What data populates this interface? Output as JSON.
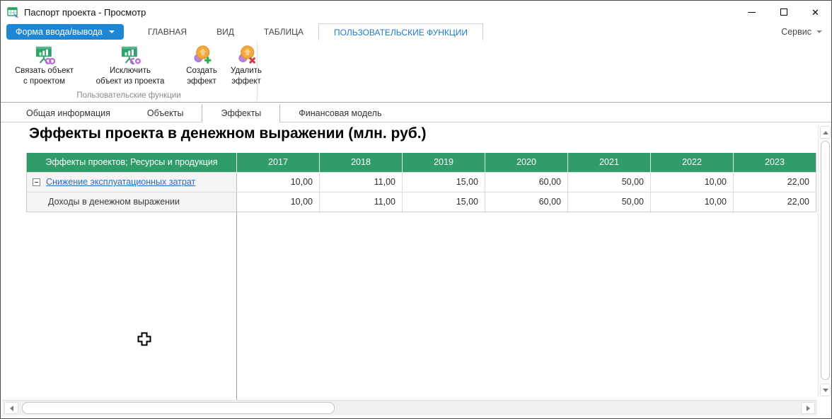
{
  "window": {
    "title": "Паспорт проекта - Просмотр"
  },
  "titlebar": {
    "icons": [
      "app-table-icon",
      "minimize-icon",
      "maximize-icon",
      "close-icon"
    ]
  },
  "ribbon": {
    "io_button": {
      "label": "Форма ввода/вывода",
      "icon": "chevron-down-icon"
    },
    "tabs": [
      {
        "label": "ГЛАВНАЯ",
        "active": false
      },
      {
        "label": "ВИД",
        "active": false
      },
      {
        "label": "ТАБЛИЦА",
        "active": false
      },
      {
        "label": "ПОЛЬЗОВАТЕЛЬСКИЕ ФУНКЦИИ",
        "active": true
      }
    ],
    "service_label": "Сервис",
    "buttons": [
      {
        "line1": "Связать объект",
        "line2": "с проектом",
        "icon": "link-object-to-project-icon"
      },
      {
        "line1": "Исключить",
        "line2": "объект из проекта",
        "icon": "unlink-object-from-project-icon"
      },
      {
        "line1": "Создать",
        "line2": "эффект",
        "icon": "create-effect-icon"
      },
      {
        "line1": "Удалить",
        "line2": "эффект",
        "icon": "delete-effect-icon"
      }
    ],
    "group_caption": "Пользовательские функции"
  },
  "page_tabs": [
    {
      "label": "Общая информация",
      "active": false
    },
    {
      "label": "Объекты",
      "active": false
    },
    {
      "label": "Эффекты",
      "active": true
    },
    {
      "label": "Финансовая модель",
      "active": false
    }
  ],
  "content": {
    "heading": "Эффекты проекта в денежном выражении (млн. руб.)"
  },
  "table": {
    "header_label": "Эффекты проектов; Ресурсы и продукция",
    "years": [
      "2017",
      "2018",
      "2019",
      "2020",
      "2021",
      "2022",
      "2023"
    ],
    "rows": [
      {
        "label": "Снижение эксплуатационных затрат",
        "type": "group-link",
        "expander": "collapsed-minus",
        "values": [
          "10,00",
          "11,00",
          "15,00",
          "60,00",
          "50,00",
          "10,00",
          "22,00"
        ]
      },
      {
        "label": "Доходы в денежном выражении",
        "type": "child",
        "values": [
          "10,00",
          "11,00",
          "15,00",
          "60,00",
          "50,00",
          "10,00",
          "22,00"
        ]
      }
    ]
  },
  "colors": {
    "header_green": "#2F9C69",
    "accent_blue": "#1E87D5",
    "link_blue": "#1B6FC9",
    "active_tab_blue": "#1E7BD0"
  }
}
